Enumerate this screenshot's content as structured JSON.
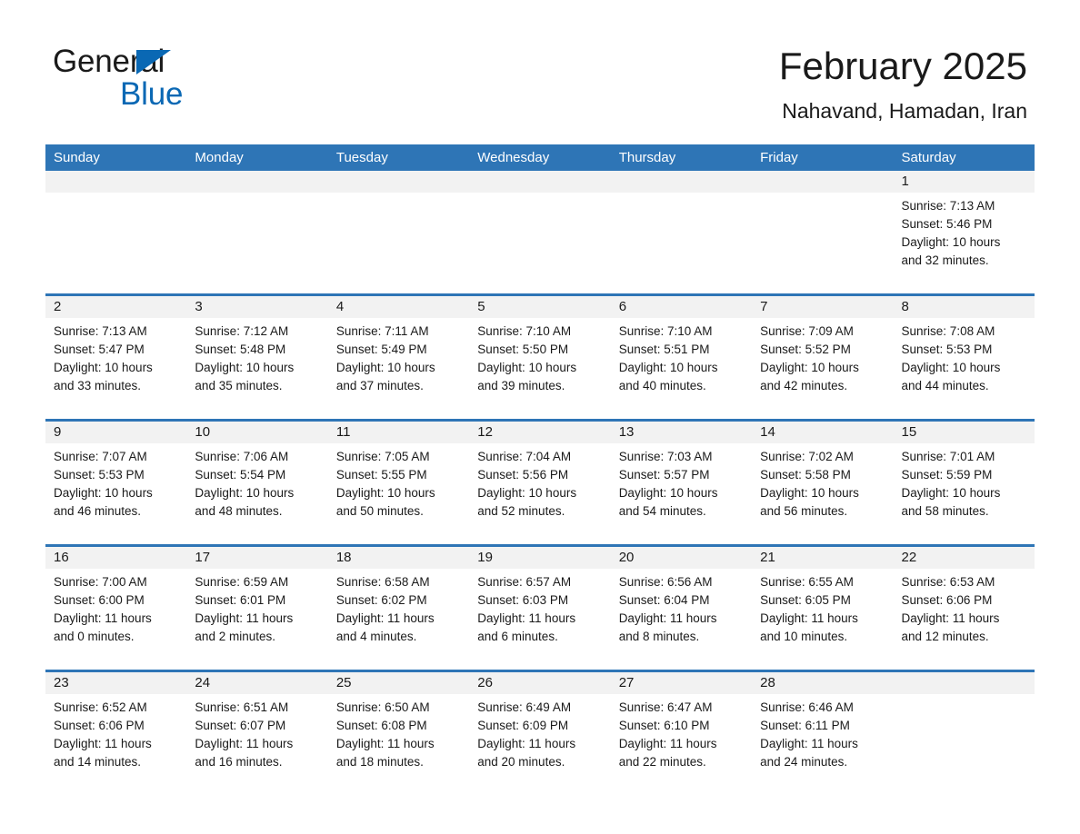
{
  "logo": {
    "text_part1": "General",
    "text_part2": "Blue",
    "triangle_color": "#0a68b4",
    "icon": "triangle-icon"
  },
  "header": {
    "title": "February 2025",
    "subtitle": "Nahavand, Hamadan, Iran"
  },
  "colors": {
    "header_blue": "#2e75b6",
    "row_divider_blue": "#2e75b6",
    "daynum_band_gray": "#f2f2f2",
    "text": "#1a1a1a",
    "logo_blue": "#0a68b4"
  },
  "weekdays": [
    "Sunday",
    "Monday",
    "Tuesday",
    "Wednesday",
    "Thursday",
    "Friday",
    "Saturday"
  ],
  "weeks": [
    [
      {
        "day": "",
        "empty": true,
        "sunrise": "",
        "sunset": "",
        "daylight_line1": "",
        "daylight_line2": ""
      },
      {
        "day": "",
        "empty": true,
        "sunrise": "",
        "sunset": "",
        "daylight_line1": "",
        "daylight_line2": ""
      },
      {
        "day": "",
        "empty": true,
        "sunrise": "",
        "sunset": "",
        "daylight_line1": "",
        "daylight_line2": ""
      },
      {
        "day": "",
        "empty": true,
        "sunrise": "",
        "sunset": "",
        "daylight_line1": "",
        "daylight_line2": ""
      },
      {
        "day": "",
        "empty": true,
        "sunrise": "",
        "sunset": "",
        "daylight_line1": "",
        "daylight_line2": ""
      },
      {
        "day": "",
        "empty": true,
        "sunrise": "",
        "sunset": "",
        "daylight_line1": "",
        "daylight_line2": ""
      },
      {
        "day": "1",
        "empty": false,
        "sunrise": "Sunrise: 7:13 AM",
        "sunset": "Sunset: 5:46 PM",
        "daylight_line1": "Daylight: 10 hours",
        "daylight_line2": "and 32 minutes."
      }
    ],
    [
      {
        "day": "2",
        "empty": false,
        "sunrise": "Sunrise: 7:13 AM",
        "sunset": "Sunset: 5:47 PM",
        "daylight_line1": "Daylight: 10 hours",
        "daylight_line2": "and 33 minutes."
      },
      {
        "day": "3",
        "empty": false,
        "sunrise": "Sunrise: 7:12 AM",
        "sunset": "Sunset: 5:48 PM",
        "daylight_line1": "Daylight: 10 hours",
        "daylight_line2": "and 35 minutes."
      },
      {
        "day": "4",
        "empty": false,
        "sunrise": "Sunrise: 7:11 AM",
        "sunset": "Sunset: 5:49 PM",
        "daylight_line1": "Daylight: 10 hours",
        "daylight_line2": "and 37 minutes."
      },
      {
        "day": "5",
        "empty": false,
        "sunrise": "Sunrise: 7:10 AM",
        "sunset": "Sunset: 5:50 PM",
        "daylight_line1": "Daylight: 10 hours",
        "daylight_line2": "and 39 minutes."
      },
      {
        "day": "6",
        "empty": false,
        "sunrise": "Sunrise: 7:10 AM",
        "sunset": "Sunset: 5:51 PM",
        "daylight_line1": "Daylight: 10 hours",
        "daylight_line2": "and 40 minutes."
      },
      {
        "day": "7",
        "empty": false,
        "sunrise": "Sunrise: 7:09 AM",
        "sunset": "Sunset: 5:52 PM",
        "daylight_line1": "Daylight: 10 hours",
        "daylight_line2": "and 42 minutes."
      },
      {
        "day": "8",
        "empty": false,
        "sunrise": "Sunrise: 7:08 AM",
        "sunset": "Sunset: 5:53 PM",
        "daylight_line1": "Daylight: 10 hours",
        "daylight_line2": "and 44 minutes."
      }
    ],
    [
      {
        "day": "9",
        "empty": false,
        "sunrise": "Sunrise: 7:07 AM",
        "sunset": "Sunset: 5:53 PM",
        "daylight_line1": "Daylight: 10 hours",
        "daylight_line2": "and 46 minutes."
      },
      {
        "day": "10",
        "empty": false,
        "sunrise": "Sunrise: 7:06 AM",
        "sunset": "Sunset: 5:54 PM",
        "daylight_line1": "Daylight: 10 hours",
        "daylight_line2": "and 48 minutes."
      },
      {
        "day": "11",
        "empty": false,
        "sunrise": "Sunrise: 7:05 AM",
        "sunset": "Sunset: 5:55 PM",
        "daylight_line1": "Daylight: 10 hours",
        "daylight_line2": "and 50 minutes."
      },
      {
        "day": "12",
        "empty": false,
        "sunrise": "Sunrise: 7:04 AM",
        "sunset": "Sunset: 5:56 PM",
        "daylight_line1": "Daylight: 10 hours",
        "daylight_line2": "and 52 minutes."
      },
      {
        "day": "13",
        "empty": false,
        "sunrise": "Sunrise: 7:03 AM",
        "sunset": "Sunset: 5:57 PM",
        "daylight_line1": "Daylight: 10 hours",
        "daylight_line2": "and 54 minutes."
      },
      {
        "day": "14",
        "empty": false,
        "sunrise": "Sunrise: 7:02 AM",
        "sunset": "Sunset: 5:58 PM",
        "daylight_line1": "Daylight: 10 hours",
        "daylight_line2": "and 56 minutes."
      },
      {
        "day": "15",
        "empty": false,
        "sunrise": "Sunrise: 7:01 AM",
        "sunset": "Sunset: 5:59 PM",
        "daylight_line1": "Daylight: 10 hours",
        "daylight_line2": "and 58 minutes."
      }
    ],
    [
      {
        "day": "16",
        "empty": false,
        "sunrise": "Sunrise: 7:00 AM",
        "sunset": "Sunset: 6:00 PM",
        "daylight_line1": "Daylight: 11 hours",
        "daylight_line2": "and 0 minutes."
      },
      {
        "day": "17",
        "empty": false,
        "sunrise": "Sunrise: 6:59 AM",
        "sunset": "Sunset: 6:01 PM",
        "daylight_line1": "Daylight: 11 hours",
        "daylight_line2": "and 2 minutes."
      },
      {
        "day": "18",
        "empty": false,
        "sunrise": "Sunrise: 6:58 AM",
        "sunset": "Sunset: 6:02 PM",
        "daylight_line1": "Daylight: 11 hours",
        "daylight_line2": "and 4 minutes."
      },
      {
        "day": "19",
        "empty": false,
        "sunrise": "Sunrise: 6:57 AM",
        "sunset": "Sunset: 6:03 PM",
        "daylight_line1": "Daylight: 11 hours",
        "daylight_line2": "and 6 minutes."
      },
      {
        "day": "20",
        "empty": false,
        "sunrise": "Sunrise: 6:56 AM",
        "sunset": "Sunset: 6:04 PM",
        "daylight_line1": "Daylight: 11 hours",
        "daylight_line2": "and 8 minutes."
      },
      {
        "day": "21",
        "empty": false,
        "sunrise": "Sunrise: 6:55 AM",
        "sunset": "Sunset: 6:05 PM",
        "daylight_line1": "Daylight: 11 hours",
        "daylight_line2": "and 10 minutes."
      },
      {
        "day": "22",
        "empty": false,
        "sunrise": "Sunrise: 6:53 AM",
        "sunset": "Sunset: 6:06 PM",
        "daylight_line1": "Daylight: 11 hours",
        "daylight_line2": "and 12 minutes."
      }
    ],
    [
      {
        "day": "23",
        "empty": false,
        "sunrise": "Sunrise: 6:52 AM",
        "sunset": "Sunset: 6:06 PM",
        "daylight_line1": "Daylight: 11 hours",
        "daylight_line2": "and 14 minutes."
      },
      {
        "day": "24",
        "empty": false,
        "sunrise": "Sunrise: 6:51 AM",
        "sunset": "Sunset: 6:07 PM",
        "daylight_line1": "Daylight: 11 hours",
        "daylight_line2": "and 16 minutes."
      },
      {
        "day": "25",
        "empty": false,
        "sunrise": "Sunrise: 6:50 AM",
        "sunset": "Sunset: 6:08 PM",
        "daylight_line1": "Daylight: 11 hours",
        "daylight_line2": "and 18 minutes."
      },
      {
        "day": "26",
        "empty": false,
        "sunrise": "Sunrise: 6:49 AM",
        "sunset": "Sunset: 6:09 PM",
        "daylight_line1": "Daylight: 11 hours",
        "daylight_line2": "and 20 minutes."
      },
      {
        "day": "27",
        "empty": false,
        "sunrise": "Sunrise: 6:47 AM",
        "sunset": "Sunset: 6:10 PM",
        "daylight_line1": "Daylight: 11 hours",
        "daylight_line2": "and 22 minutes."
      },
      {
        "day": "28",
        "empty": false,
        "sunrise": "Sunrise: 6:46 AM",
        "sunset": "Sunset: 6:11 PM",
        "daylight_line1": "Daylight: 11 hours",
        "daylight_line2": "and 24 minutes."
      },
      {
        "day": "",
        "empty": true,
        "sunrise": "",
        "sunset": "",
        "daylight_line1": "",
        "daylight_line2": ""
      }
    ]
  ]
}
